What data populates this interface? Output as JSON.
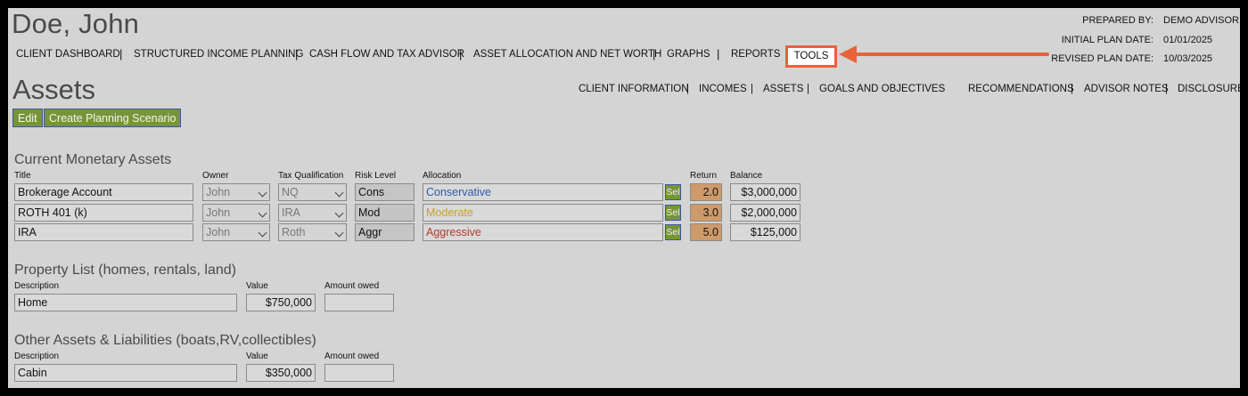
{
  "header": {
    "client_name": "Doe, John",
    "prepared_by_label": "PREPARED BY:",
    "prepared_by_value": "DEMO ADVISOR",
    "initial_plan_label": "INITIAL PLAN DATE:",
    "initial_plan_value": "01/01/2025",
    "revised_plan_label": "REVISED PLAN DATE:",
    "revised_plan_value": "10/03/2025"
  },
  "main_nav": [
    "CLIENT DASHBOARD",
    "STRUCTURED INCOME PLANNING",
    "CASH FLOW AND TAX ADVISOR",
    "ASSET ALLOCATION AND NET WORTH",
    "GRAPHS",
    "REPORTS",
    "TOOLS"
  ],
  "page": {
    "title": "Assets",
    "edit_label": "Edit",
    "scenario_label": "Create Planning Scenario"
  },
  "sub_nav_left": [
    "CLIENT INFORMATION",
    "INCOMES",
    "ASSETS",
    "GOALS AND OBJECTIVES"
  ],
  "sub_nav_right": [
    "RECOMMENDATIONS",
    "ADVISOR NOTES",
    "DISCLOSURE"
  ],
  "monetary": {
    "title": "Current Monetary Assets",
    "headers": {
      "title": "Title",
      "owner": "Owner",
      "tax": "Tax Qualification",
      "risk": "Risk Level",
      "allocation": "Allocation",
      "return": "Return",
      "balance": "Balance"
    },
    "sel_label": "Sel",
    "rows": [
      {
        "title": "Brokerage Account",
        "owner": "John",
        "tax": "NQ",
        "risk": "Cons",
        "allocation": "Conservative",
        "allocation_color": "#2e5aa8",
        "return": "2.0",
        "balance": "$3,000,000"
      },
      {
        "title": "ROTH 401 (k)",
        "owner": "John",
        "tax": "IRA",
        "risk": "Mod",
        "allocation": "Moderate",
        "allocation_color": "#c9a227",
        "return": "3.0",
        "balance": "$2,000,000"
      },
      {
        "title": "IRA",
        "owner": "John",
        "tax": "Roth",
        "risk": "Aggr",
        "allocation": "Aggressive",
        "allocation_color": "#b03a2e",
        "return": "5.0",
        "balance": "$125,000"
      }
    ]
  },
  "property": {
    "title": "Property List (homes, rentals, land)",
    "headers": {
      "description": "Description",
      "value": "Value",
      "owed": "Amount owed"
    },
    "rows": [
      {
        "description": "Home",
        "value": "$750,000",
        "owed": ""
      }
    ]
  },
  "other": {
    "title": "Other Assets & Liabilities (boats,RV,collectibles)",
    "headers": {
      "description": "Description",
      "value": "Value",
      "owed": "Amount owed"
    },
    "rows": [
      {
        "description": "Cabin",
        "value": "$350,000",
        "owed": ""
      }
    ]
  },
  "colors": {
    "background": "#d4d4d4",
    "button_green": "#78943a",
    "highlight": "#e8623a",
    "return_fill": "#cf9a6a"
  }
}
